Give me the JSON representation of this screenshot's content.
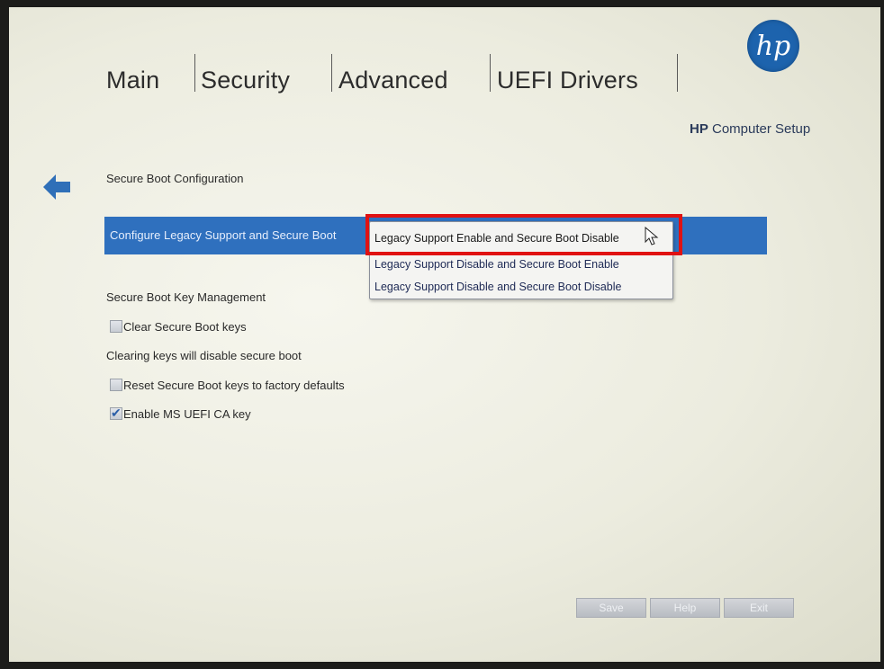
{
  "tabs": [
    {
      "label": "Main"
    },
    {
      "label": "Security"
    },
    {
      "label": "Advanced"
    },
    {
      "label": "UEFI Drivers"
    }
  ],
  "brand": {
    "logo_text": "hp",
    "tagline_bold": "HP",
    "tagline_rest": " Computer Setup"
  },
  "page": {
    "section_title": "Secure Boot Configuration",
    "legacy_row_label": "Configure Legacy Support and Secure Boot",
    "dropdown": {
      "options": [
        "Legacy Support Enable and Secure Boot Disable",
        "Legacy Support Disable and Secure Boot Enable",
        "Legacy Support Disable and Secure Boot Disable"
      ],
      "selected_index": 0
    },
    "key_mgmt_title": "Secure Boot Key Management",
    "clear_keys": {
      "label": "Clear Secure Boot keys",
      "checked": false
    },
    "clear_keys_note": "Clearing keys will disable secure boot",
    "reset_keys": {
      "label": "Reset Secure Boot keys to factory defaults",
      "checked": false
    },
    "enable_ms_key": {
      "label": "Enable MS UEFI CA key",
      "checked": true
    }
  },
  "buttons": {
    "save": "Save",
    "help": "Help",
    "exit": "Exit"
  },
  "colors": {
    "highlight_row": "#2f70be",
    "annotation_box": "#e01212",
    "accent": "#1d63ad"
  },
  "icons": {
    "back": "back-arrow-icon",
    "cursor": "mouse-pointer-icon"
  }
}
